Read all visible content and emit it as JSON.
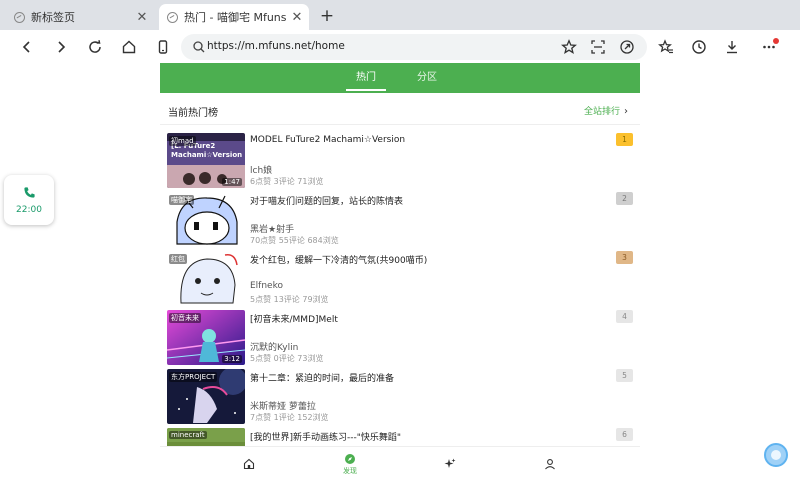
{
  "browser": {
    "tabs": [
      {
        "title": "新标签页",
        "active": false
      },
      {
        "title": "热门 - 喵御宅 Mfuns",
        "active": true
      }
    ],
    "close_glyph": "✕",
    "newtab_glyph": "+",
    "url": "https://m.mfuns.net/home"
  },
  "header": {
    "tabs": [
      {
        "label": "热门",
        "active": true
      },
      {
        "label": "分区",
        "active": false
      }
    ]
  },
  "ranking": {
    "title": "当前热门榜",
    "link": "全站排行",
    "link_chevron": "›"
  },
  "videos": [
    {
      "rank": "1",
      "title": "MODEL FuTure2 Machami☆Version",
      "author": "lch娘",
      "stats": "6点赞 3评论 71浏览",
      "tag": "初mad",
      "duration": "1:47",
      "thumb_text": "[L. FuTure2 Machami☆Version"
    },
    {
      "rank": "2",
      "title": "对于喵友们问题的回复，站长的陈情表",
      "author": "黑岩★射手",
      "stats": "70点赞 55评论 684浏览",
      "tag": "喵御宅",
      "duration": ""
    },
    {
      "rank": "3",
      "title": "发个红包，缓解一下冷清的气氛(共900喵币)",
      "author": "Elfneko",
      "stats": "5点赞 13评论 79浏览",
      "tag": "红包",
      "duration": ""
    },
    {
      "rank": "4",
      "title": "[初音未来/MMD]Melt",
      "author": "沉默的Kylin",
      "stats": "5点赞 0评论 73浏览",
      "tag": "初音未来",
      "duration": "3:12"
    },
    {
      "rank": "5",
      "title": "第十二章：紧迫的时间，最后的准备",
      "author": "米斯蒂娅 萝蕾拉",
      "stats": "7点赞 1评论 152浏览",
      "tag": "东方PROJECT",
      "duration": ""
    },
    {
      "rank": "6",
      "title": "[我的世界]新手动画练习---\"快乐舞蹈\"",
      "author": "",
      "stats": "",
      "tag": "minecraft",
      "duration": ""
    }
  ],
  "bottom_nav": [
    {
      "icon": "home-icon",
      "label": ""
    },
    {
      "icon": "discover-icon",
      "label": "发现"
    },
    {
      "icon": "sparkle-icon",
      "label": ""
    },
    {
      "icon": "user-icon",
      "label": ""
    }
  ],
  "call_widget": {
    "time": "22:00"
  },
  "colors": {
    "brand_green": "#4caf50",
    "rank1": "#fbc02d",
    "rank3": "#e0b787"
  }
}
